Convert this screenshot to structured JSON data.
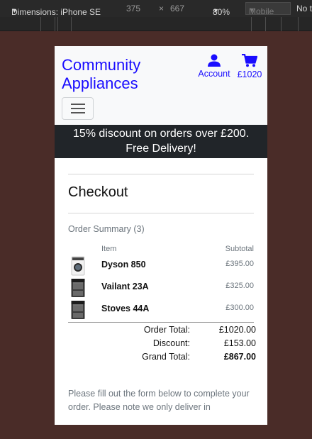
{
  "devtools": {
    "dimensions_label": "Dimensions: iPhone SE",
    "width": "375",
    "times": "×",
    "height": "667",
    "zoom": "80%",
    "mode": "Mobile",
    "throttle": "No t"
  },
  "header": {
    "brand_line1": "Community",
    "brand_line2": "Appliances",
    "account_label": "Account",
    "cart_total": "£1020"
  },
  "promo": {
    "line1": "15% discount on orders over £200.",
    "line2": "Free Delivery!"
  },
  "checkout": {
    "title": "Checkout",
    "summary_heading": "Order Summary (3)",
    "col_item": "Item",
    "col_subtotal": "Subtotal",
    "items": [
      {
        "name": "Dyson 850",
        "price": "£395.00",
        "icon": "washing-machine-thumbnail"
      },
      {
        "name": "Vailant 23A",
        "price": "£325.00",
        "icon": "range-cooker-thumbnail"
      },
      {
        "name": "Stoves 44A",
        "price": "£300.00",
        "icon": "range-cooker-thumbnail"
      }
    ],
    "order_total_label": "Order Total:",
    "order_total": "£1020.00",
    "discount_label": "Discount:",
    "discount": "£153.00",
    "grand_total_label": "Grand Total:",
    "grand_total": "£867.00",
    "note": "Please fill out the form below to complete your order. Please note we only deliver in"
  },
  "colors": {
    "brand": "#1a0dff",
    "promo_bg": "#212529",
    "page_bg": "#4a2c28"
  }
}
